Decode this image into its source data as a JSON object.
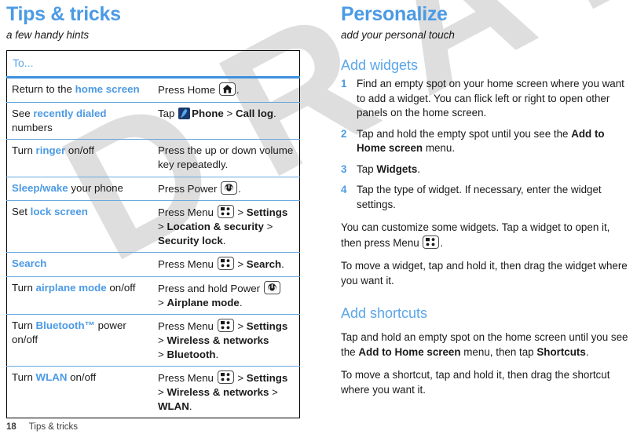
{
  "watermark": {
    "text": "DRAFT"
  },
  "left": {
    "chapter_title": "Tips & tricks",
    "chapter_subtitle": "a few handy hints",
    "table": {
      "header": "To...",
      "rows": [
        {
          "task_pre": "Return to the ",
          "task_blue": "home screen",
          "task_post": "",
          "action_lines": [
            {
              "parts": [
                {
                  "t": "Press Home ",
                  "s": "n"
                },
                {
                  "t": "",
                  "s": "icon-home"
                },
                {
                  "t": ".",
                  "s": "n"
                }
              ]
            }
          ]
        },
        {
          "task_pre": "See ",
          "task_blue": "recently dialed",
          "task_post": " numbers",
          "action_lines": [
            {
              "parts": [
                {
                  "t": "Tap ",
                  "s": "n"
                },
                {
                  "t": "",
                  "s": "icon-phone"
                },
                {
                  "t": "Phone",
                  "s": "b"
                },
                {
                  "t": " > ",
                  "s": "n"
                },
                {
                  "t": "Call log",
                  "s": "b"
                },
                {
                  "t": ".",
                  "s": "n"
                }
              ]
            }
          ]
        },
        {
          "task_pre": "Turn ",
          "task_blue": "ringer",
          "task_post": " on/off",
          "action_lines": [
            {
              "parts": [
                {
                  "t": "Press the up or down volume key repeatedly.",
                  "s": "n"
                }
              ]
            }
          ]
        },
        {
          "task_pre": "",
          "task_blue": "Sleep/wake",
          "task_post": " your phone",
          "action_lines": [
            {
              "parts": [
                {
                  "t": "Press Power ",
                  "s": "n"
                },
                {
                  "t": "",
                  "s": "icon-power"
                },
                {
                  "t": ".",
                  "s": "n"
                }
              ]
            }
          ]
        },
        {
          "task_pre": "Set ",
          "task_blue": "lock screen",
          "task_post": "",
          "action_lines": [
            {
              "parts": [
                {
                  "t": "Press Menu ",
                  "s": "n"
                },
                {
                  "t": "",
                  "s": "icon-menu"
                },
                {
                  "t": " > ",
                  "s": "n"
                },
                {
                  "t": "Settings",
                  "s": "b"
                }
              ]
            },
            {
              "parts": [
                {
                  "t": "> ",
                  "s": "n"
                },
                {
                  "t": "Location & security",
                  "s": "b"
                },
                {
                  "t": " > ",
                  "s": "n"
                },
                {
                  "t": "Security lock",
                  "s": "b"
                },
                {
                  "t": ".",
                  "s": "n"
                }
              ]
            }
          ]
        },
        {
          "task_pre": "",
          "task_blue": "Search",
          "task_post": "",
          "action_lines": [
            {
              "parts": [
                {
                  "t": "Press Menu ",
                  "s": "n"
                },
                {
                  "t": "",
                  "s": "icon-menu"
                },
                {
                  "t": " > ",
                  "s": "n"
                },
                {
                  "t": "Search",
                  "s": "b"
                },
                {
                  "t": ".",
                  "s": "n"
                }
              ]
            }
          ]
        },
        {
          "task_pre": "Turn ",
          "task_blue": "airplane mode",
          "task_post": " on/off",
          "action_lines": [
            {
              "parts": [
                {
                  "t": "Press and hold Power ",
                  "s": "n"
                },
                {
                  "t": "",
                  "s": "icon-power"
                }
              ]
            },
            {
              "parts": [
                {
                  "t": "> ",
                  "s": "n"
                },
                {
                  "t": "Airplane mode",
                  "s": "b"
                },
                {
                  "t": ".",
                  "s": "n"
                }
              ]
            }
          ]
        },
        {
          "task_pre": "Turn ",
          "task_blue": "Bluetooth™",
          "task_post": " power on/off",
          "action_lines": [
            {
              "parts": [
                {
                  "t": "Press Menu ",
                  "s": "n"
                },
                {
                  "t": "",
                  "s": "icon-menu"
                },
                {
                  "t": " > ",
                  "s": "n"
                },
                {
                  "t": "Settings",
                  "s": "b"
                }
              ]
            },
            {
              "parts": [
                {
                  "t": "> ",
                  "s": "n"
                },
                {
                  "t": "Wireless & networks",
                  "s": "b"
                }
              ]
            },
            {
              "parts": [
                {
                  "t": "> ",
                  "s": "n"
                },
                {
                  "t": "Bluetooth",
                  "s": "b"
                },
                {
                  "t": ".",
                  "s": "n"
                }
              ]
            }
          ]
        },
        {
          "task_pre": "Turn ",
          "task_blue": "WLAN",
          "task_post": " on/off",
          "action_lines": [
            {
              "parts": [
                {
                  "t": "Press Menu ",
                  "s": "n"
                },
                {
                  "t": "",
                  "s": "icon-menu"
                },
                {
                  "t": " > ",
                  "s": "n"
                },
                {
                  "t": "Settings",
                  "s": "b"
                }
              ]
            },
            {
              "parts": [
                {
                  "t": "> ",
                  "s": "n"
                },
                {
                  "t": "Wireless & networks",
                  "s": "b"
                },
                {
                  "t": " > ",
                  "s": "n"
                },
                {
                  "t": "WLAN",
                  "s": "b"
                },
                {
                  "t": ".",
                  "s": "n"
                }
              ]
            }
          ]
        }
      ]
    }
  },
  "right": {
    "chapter_title": "Personalize",
    "chapter_subtitle": "add your personal touch",
    "sections": [
      {
        "heading": "Add widgets",
        "steps": [
          {
            "num": "1",
            "parts": [
              {
                "t": "Find an empty spot on your home screen where you want to add a widget. You can flick left or right to open other panels on the home screen.",
                "s": "n"
              }
            ]
          },
          {
            "num": "2",
            "parts": [
              {
                "t": "Tap and hold the empty spot until you see the ",
                "s": "n"
              },
              {
                "t": "Add to Home screen",
                "s": "b"
              },
              {
                "t": " menu.",
                "s": "n"
              }
            ]
          },
          {
            "num": "3",
            "parts": [
              {
                "t": "Tap ",
                "s": "n"
              },
              {
                "t": "Widgets",
                "s": "b"
              },
              {
                "t": ".",
                "s": "n"
              }
            ]
          },
          {
            "num": "4",
            "parts": [
              {
                "t": "Tap the type of widget. If necessary, enter the widget settings.",
                "s": "n"
              }
            ]
          }
        ],
        "paragraphs": [
          {
            "parts": [
              {
                "t": "You can customize some widgets. Tap a widget to open it, then press Menu ",
                "s": "n"
              },
              {
                "t": "",
                "s": "icon-menu"
              },
              {
                "t": ".",
                "s": "n"
              }
            ]
          },
          {
            "parts": [
              {
                "t": "To move a widget, tap and hold it, then drag the widget where you want it.",
                "s": "n"
              }
            ]
          }
        ]
      },
      {
        "heading": "Add shortcuts",
        "steps": [],
        "paragraphs": [
          {
            "parts": [
              {
                "t": "Tap and hold an empty spot on the home screen until you see the ",
                "s": "n"
              },
              {
                "t": "Add to Home screen",
                "s": "b"
              },
              {
                "t": " menu, then tap ",
                "s": "n"
              },
              {
                "t": "Shortcuts",
                "s": "b"
              },
              {
                "t": ".",
                "s": "n"
              }
            ]
          },
          {
            "parts": [
              {
                "t": "To move a shortcut, tap and hold it, then drag the shortcut where you want it.",
                "s": "n"
              }
            ]
          }
        ]
      }
    ]
  },
  "footer": {
    "page_number": "18",
    "chapter_label": "Tips & tricks"
  },
  "colors": {
    "accent_blue": "#4b9ae4",
    "heading_blue": "#5aa6ea",
    "rule_blue": "#6aa9e0",
    "watermark_gray": "#d9d9d9",
    "phone_icon_bg": "#1b3a6b"
  }
}
